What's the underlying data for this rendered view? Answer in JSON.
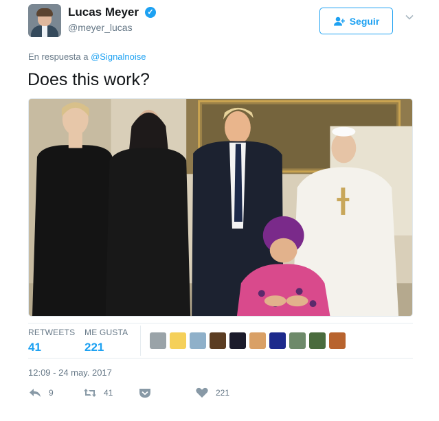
{
  "user": {
    "name": "Lucas Meyer",
    "handle": "@meyer_lucas",
    "verified_glyph": "✓"
  },
  "follow_button": {
    "label": "Seguir",
    "icon": "add-user-icon"
  },
  "reply": {
    "prefix": "En respuesta a",
    "mention": "@Signalnoise"
  },
  "tweet": {
    "text": "Does this work?"
  },
  "stats": {
    "retweets_label": "RETWEETS",
    "retweets_value": "41",
    "likes_label": "ME GUSTA",
    "likes_value": "221"
  },
  "likers": [
    {
      "color": "#9aa3a8"
    },
    {
      "color": "#f5d05a"
    },
    {
      "color": "#8fb0c9"
    },
    {
      "color": "#5b3d22"
    },
    {
      "color": "#1b1b2b"
    },
    {
      "color": "#d9a066"
    },
    {
      "color": "#1d2a8c"
    },
    {
      "color": "#6e8a6a"
    },
    {
      "color": "#4a6b3d"
    },
    {
      "color": "#b8632e"
    }
  ],
  "timestamp": "12:09 - 24 may. 2017",
  "actions": {
    "reply_count": "9",
    "retweet_count": "41",
    "like_count": "221"
  },
  "colors": {
    "accent": "#1da1f2",
    "muted": "#657786",
    "text": "#14171a"
  }
}
